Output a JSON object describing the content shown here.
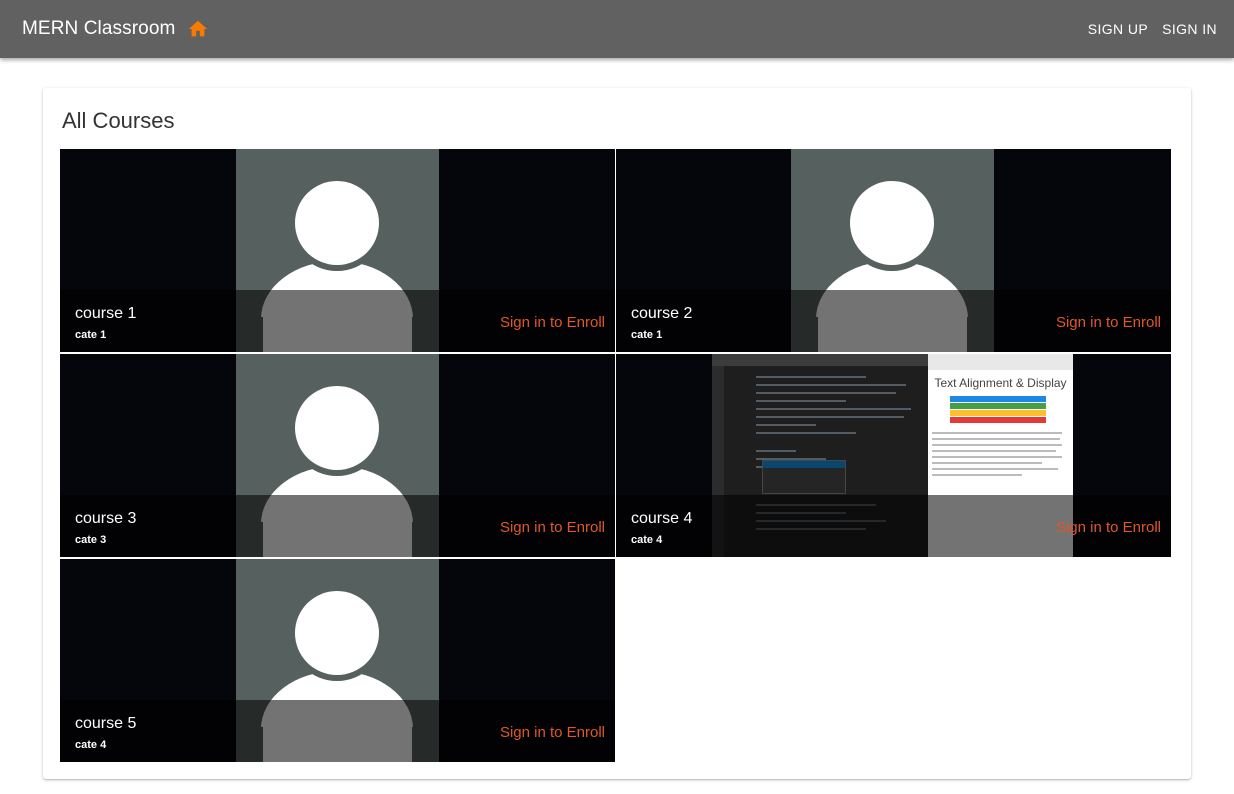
{
  "appbar": {
    "title": "MERN Classroom",
    "home_icon": "home-icon",
    "accent": "#f57c00",
    "sign_up": "SIGN UP",
    "sign_in": "SIGN IN",
    "background": "#616161"
  },
  "main": {
    "title": "All Courses",
    "courses": [
      {
        "name": "course 1",
        "category": "cate 1",
        "action": "Sign in to Enroll",
        "image": "avatar-placeholder"
      },
      {
        "name": "course 2",
        "category": "cate 1",
        "action": "Sign in to Enroll",
        "image": "avatar-placeholder"
      },
      {
        "name": "course 3",
        "category": "cate 3",
        "action": "Sign in to Enroll",
        "image": "avatar-placeholder"
      },
      {
        "name": "course 4",
        "category": "cate 4",
        "action": "Sign in to Enroll",
        "image": "code-editor-screenshot",
        "image_caption": "Text Alignment & Display"
      },
      {
        "name": "course 5",
        "category": "cate 4",
        "action": "Sign in to Enroll",
        "image": "avatar-placeholder"
      }
    ],
    "enroll_color": "#e0572a"
  }
}
